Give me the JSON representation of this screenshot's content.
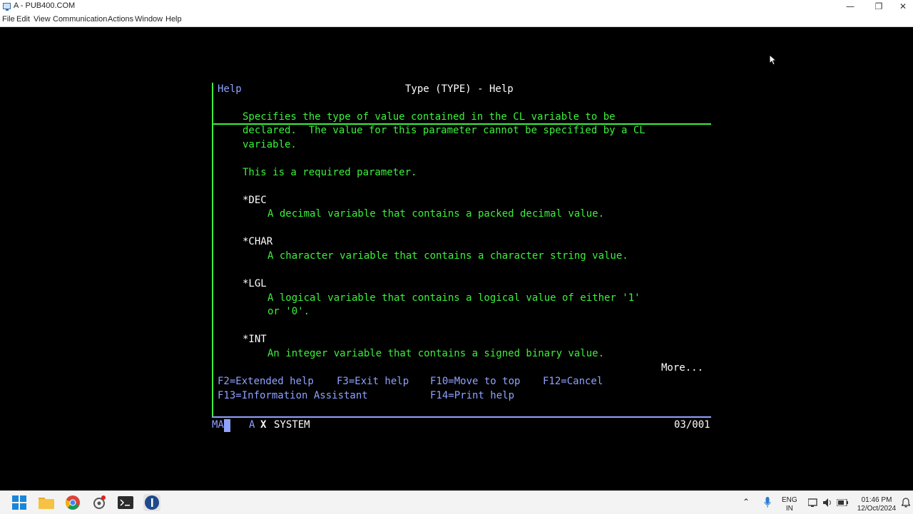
{
  "window": {
    "title": "A - PUB400.COM",
    "minimize": "—",
    "restore": "❐",
    "close": "✕"
  },
  "menu": [
    "File",
    "Edit",
    "View",
    "Communication",
    "Actions",
    "Window",
    "Help"
  ],
  "screen": {
    "help_label": "Help",
    "title": "Type (TYPE) - Help",
    "lines": [
      "Specifies the type of value contained in the CL variable to be",
      "declared.  The value for this parameter cannot be specified by a CL",
      "variable.",
      "This is a required parameter."
    ],
    "options": [
      {
        "name": "*DEC",
        "desc": [
          "A decimal variable that contains a packed decimal value."
        ]
      },
      {
        "name": "*CHAR",
        "desc": [
          "A character variable that contains a character string value."
        ]
      },
      {
        "name": "*LGL",
        "desc": [
          "A logical variable that contains a logical value of either '1'",
          "or '0'."
        ]
      },
      {
        "name": "*INT",
        "desc": [
          "An integer variable that contains a signed binary value."
        ]
      }
    ],
    "more": "More...",
    "fkeys": {
      "f2": "F2=Extended help",
      "f3": "F3=Exit help",
      "f10": "F10=Move to top",
      "f12": "F12=Cancel",
      "f13": "F13=Information Assistant",
      "f14": "F14=Print help"
    }
  },
  "status": {
    "ma": "MA",
    "session": "A",
    "x": "X",
    "system": "SYSTEM",
    "position": "03/001"
  },
  "taskbar": {
    "lang_line1": "ENG",
    "lang_line2": "IN",
    "time": "01:46 PM",
    "date": "12/Oct/2024"
  },
  "colors": {
    "green": "#3cf03c",
    "blue": "#8fa2ff",
    "white": "#ffffff",
    "background": "#000000"
  }
}
